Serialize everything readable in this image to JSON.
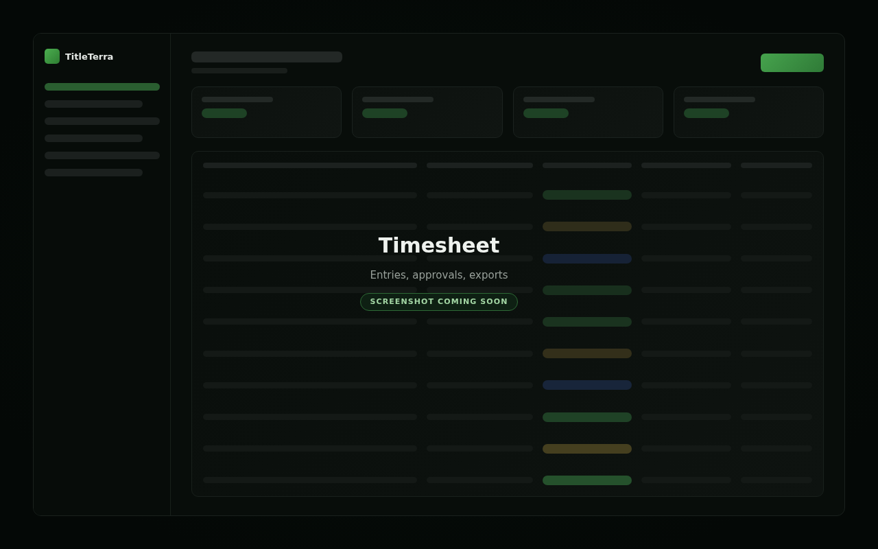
{
  "sidebar": {
    "brand": "TitleTerra",
    "items": [
      {
        "selected": true
      },
      {
        "selected": false
      },
      {
        "selected": false
      },
      {
        "selected": false
      },
      {
        "selected": false
      },
      {
        "selected": false
      }
    ]
  },
  "table": {
    "rows": [
      {
        "color": "#1a331f"
      },
      {
        "color": "#2f2d1a"
      },
      {
        "color": "#162236"
      },
      {
        "color": "#182f1d"
      },
      {
        "color": "#1a331f"
      },
      {
        "color": "#332f1a"
      },
      {
        "color": "#18253a"
      },
      {
        "color": "#1f4226"
      },
      {
        "color": "#453f1f"
      },
      {
        "color": "#25512c"
      }
    ]
  },
  "overlay": {
    "title": "Timesheet",
    "subtitle": "Entries, approvals, exports",
    "badge": "SCREENSHOT COMING SOON"
  }
}
